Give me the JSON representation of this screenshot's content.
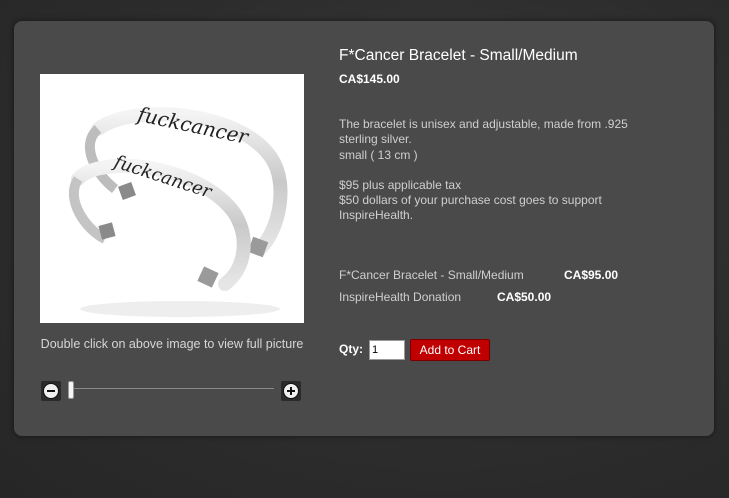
{
  "product": {
    "title": "F*Cancer Bracelet - Small/Medium",
    "price": "CA$145.00",
    "description": [
      "The bracelet is unisex and adjustable, made from .925",
      "sterling silver.",
      "small ( 13 cm )"
    ],
    "tax_note": "$95 plus applicable tax",
    "donation_note": [
      "$50 dollars of your purchase cost goes to support",
      "InspireHealth."
    ],
    "image_engraving": "fuckcancer"
  },
  "image_hint": "Double click on above image to view full picture",
  "breakdown": [
    {
      "label": "F*Cancer Bracelet - Small/Medium",
      "amount": "CA$95.00"
    },
    {
      "label": "InspireHealth Donation",
      "amount": "CA$50.00"
    }
  ],
  "cart": {
    "qty_label": "Qty:",
    "qty_value": "1",
    "add_label": "Add to Cart"
  },
  "zoom": {
    "level": 0,
    "minus_icon": "zoom-out-icon",
    "plus_icon": "zoom-in-icon"
  },
  "colors": {
    "panel": "#4a4a4a",
    "button": "#c00000"
  }
}
